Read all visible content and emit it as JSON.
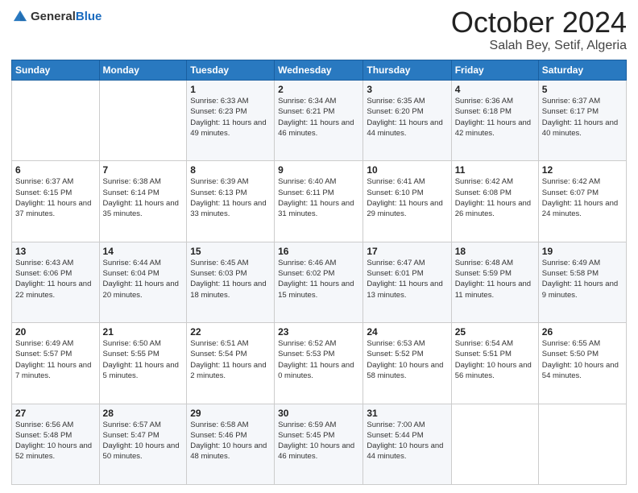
{
  "logo": {
    "general": "General",
    "blue": "Blue"
  },
  "header": {
    "month": "October 2024",
    "location": "Salah Bey, Setif, Algeria"
  },
  "days_of_week": [
    "Sunday",
    "Monday",
    "Tuesday",
    "Wednesday",
    "Thursday",
    "Friday",
    "Saturday"
  ],
  "weeks": [
    [
      {
        "day": "",
        "info": ""
      },
      {
        "day": "",
        "info": ""
      },
      {
        "day": "1",
        "info": "Sunrise: 6:33 AM\nSunset: 6:23 PM\nDaylight: 11 hours and 49 minutes."
      },
      {
        "day": "2",
        "info": "Sunrise: 6:34 AM\nSunset: 6:21 PM\nDaylight: 11 hours and 46 minutes."
      },
      {
        "day": "3",
        "info": "Sunrise: 6:35 AM\nSunset: 6:20 PM\nDaylight: 11 hours and 44 minutes."
      },
      {
        "day": "4",
        "info": "Sunrise: 6:36 AM\nSunset: 6:18 PM\nDaylight: 11 hours and 42 minutes."
      },
      {
        "day": "5",
        "info": "Sunrise: 6:37 AM\nSunset: 6:17 PM\nDaylight: 11 hours and 40 minutes."
      }
    ],
    [
      {
        "day": "6",
        "info": "Sunrise: 6:37 AM\nSunset: 6:15 PM\nDaylight: 11 hours and 37 minutes."
      },
      {
        "day": "7",
        "info": "Sunrise: 6:38 AM\nSunset: 6:14 PM\nDaylight: 11 hours and 35 minutes."
      },
      {
        "day": "8",
        "info": "Sunrise: 6:39 AM\nSunset: 6:13 PM\nDaylight: 11 hours and 33 minutes."
      },
      {
        "day": "9",
        "info": "Sunrise: 6:40 AM\nSunset: 6:11 PM\nDaylight: 11 hours and 31 minutes."
      },
      {
        "day": "10",
        "info": "Sunrise: 6:41 AM\nSunset: 6:10 PM\nDaylight: 11 hours and 29 minutes."
      },
      {
        "day": "11",
        "info": "Sunrise: 6:42 AM\nSunset: 6:08 PM\nDaylight: 11 hours and 26 minutes."
      },
      {
        "day": "12",
        "info": "Sunrise: 6:42 AM\nSunset: 6:07 PM\nDaylight: 11 hours and 24 minutes."
      }
    ],
    [
      {
        "day": "13",
        "info": "Sunrise: 6:43 AM\nSunset: 6:06 PM\nDaylight: 11 hours and 22 minutes."
      },
      {
        "day": "14",
        "info": "Sunrise: 6:44 AM\nSunset: 6:04 PM\nDaylight: 11 hours and 20 minutes."
      },
      {
        "day": "15",
        "info": "Sunrise: 6:45 AM\nSunset: 6:03 PM\nDaylight: 11 hours and 18 minutes."
      },
      {
        "day": "16",
        "info": "Sunrise: 6:46 AM\nSunset: 6:02 PM\nDaylight: 11 hours and 15 minutes."
      },
      {
        "day": "17",
        "info": "Sunrise: 6:47 AM\nSunset: 6:01 PM\nDaylight: 11 hours and 13 minutes."
      },
      {
        "day": "18",
        "info": "Sunrise: 6:48 AM\nSunset: 5:59 PM\nDaylight: 11 hours and 11 minutes."
      },
      {
        "day": "19",
        "info": "Sunrise: 6:49 AM\nSunset: 5:58 PM\nDaylight: 11 hours and 9 minutes."
      }
    ],
    [
      {
        "day": "20",
        "info": "Sunrise: 6:49 AM\nSunset: 5:57 PM\nDaylight: 11 hours and 7 minutes."
      },
      {
        "day": "21",
        "info": "Sunrise: 6:50 AM\nSunset: 5:55 PM\nDaylight: 11 hours and 5 minutes."
      },
      {
        "day": "22",
        "info": "Sunrise: 6:51 AM\nSunset: 5:54 PM\nDaylight: 11 hours and 2 minutes."
      },
      {
        "day": "23",
        "info": "Sunrise: 6:52 AM\nSunset: 5:53 PM\nDaylight: 11 hours and 0 minutes."
      },
      {
        "day": "24",
        "info": "Sunrise: 6:53 AM\nSunset: 5:52 PM\nDaylight: 10 hours and 58 minutes."
      },
      {
        "day": "25",
        "info": "Sunrise: 6:54 AM\nSunset: 5:51 PM\nDaylight: 10 hours and 56 minutes."
      },
      {
        "day": "26",
        "info": "Sunrise: 6:55 AM\nSunset: 5:50 PM\nDaylight: 10 hours and 54 minutes."
      }
    ],
    [
      {
        "day": "27",
        "info": "Sunrise: 6:56 AM\nSunset: 5:48 PM\nDaylight: 10 hours and 52 minutes."
      },
      {
        "day": "28",
        "info": "Sunrise: 6:57 AM\nSunset: 5:47 PM\nDaylight: 10 hours and 50 minutes."
      },
      {
        "day": "29",
        "info": "Sunrise: 6:58 AM\nSunset: 5:46 PM\nDaylight: 10 hours and 48 minutes."
      },
      {
        "day": "30",
        "info": "Sunrise: 6:59 AM\nSunset: 5:45 PM\nDaylight: 10 hours and 46 minutes."
      },
      {
        "day": "31",
        "info": "Sunrise: 7:00 AM\nSunset: 5:44 PM\nDaylight: 10 hours and 44 minutes."
      },
      {
        "day": "",
        "info": ""
      },
      {
        "day": "",
        "info": ""
      }
    ]
  ]
}
